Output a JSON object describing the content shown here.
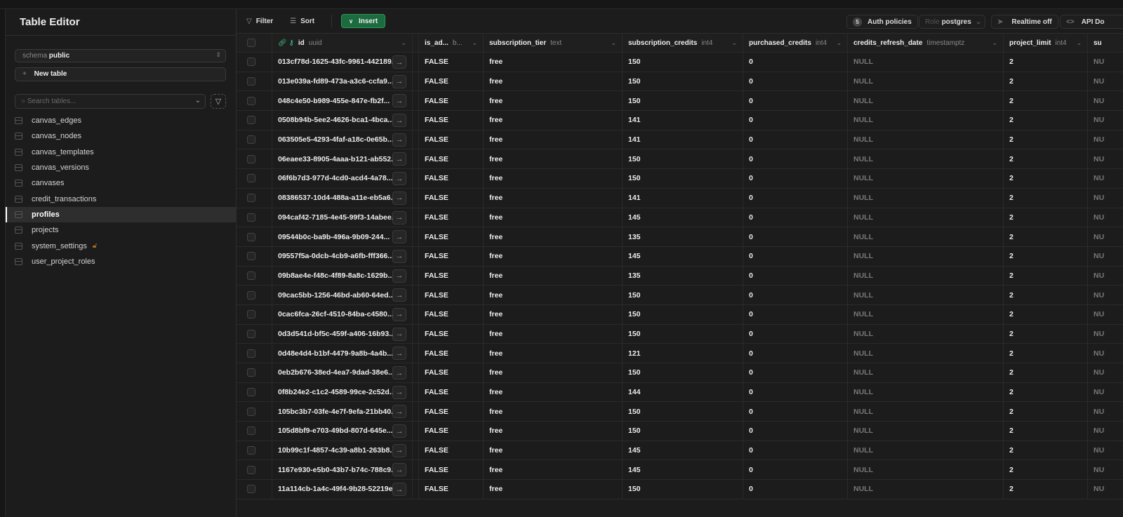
{
  "sidebar": {
    "title": "Table Editor",
    "schema_label": "schema",
    "schema_value": "public",
    "new_table": "New table",
    "search_placeholder": "Search tables...",
    "tables": [
      {
        "name": "canvas_edges"
      },
      {
        "name": "canvas_nodes"
      },
      {
        "name": "canvas_templates"
      },
      {
        "name": "canvas_versions"
      },
      {
        "name": "canvases"
      },
      {
        "name": "credit_transactions"
      },
      {
        "name": "profiles",
        "active": true
      },
      {
        "name": "projects"
      },
      {
        "name": "system_settings",
        "locked": true
      },
      {
        "name": "user_project_roles"
      }
    ]
  },
  "toolbar": {
    "filter": "Filter",
    "sort": "Sort",
    "insert": "Insert",
    "auth_count": "5",
    "auth_policies": "Auth policies",
    "role_label": "Role",
    "role_value": "postgres",
    "realtime": "Realtime off",
    "api_docs": "API Do"
  },
  "colors": {
    "accent": "#1b6b3e",
    "lock": "#b06f1d"
  },
  "columns": [
    {
      "name": "id",
      "type": "uuid"
    },
    {
      "name": "is_ad...",
      "type": "b..."
    },
    {
      "name": "subscription_tier",
      "type": "text"
    },
    {
      "name": "subscription_credits",
      "type": "int4"
    },
    {
      "name": "purchased_credits",
      "type": "int4"
    },
    {
      "name": "credits_refresh_date",
      "type": "timestamptz"
    },
    {
      "name": "project_limit",
      "type": "int4"
    },
    {
      "name": "su",
      "type": ""
    }
  ],
  "rows": [
    [
      "013cf78d-1625-43fc-9961-442189...",
      "FALSE",
      "free",
      "150",
      "0",
      "NULL",
      "2",
      "NU"
    ],
    [
      "013e039a-fd89-473a-a3c6-ccfa9...",
      "FALSE",
      "free",
      "150",
      "0",
      "NULL",
      "2",
      "NU"
    ],
    [
      "048c4e50-b989-455e-847e-fb2f...",
      "FALSE",
      "free",
      "150",
      "0",
      "NULL",
      "2",
      "NU"
    ],
    [
      "0508b94b-5ee2-4626-bca1-4bca...",
      "FALSE",
      "free",
      "141",
      "0",
      "NULL",
      "2",
      "NU"
    ],
    [
      "063505e5-4293-4faf-a18c-0e65b...",
      "FALSE",
      "free",
      "141",
      "0",
      "NULL",
      "2",
      "NU"
    ],
    [
      "06eaee33-8905-4aaa-b121-ab552...",
      "FALSE",
      "free",
      "150",
      "0",
      "NULL",
      "2",
      "NU"
    ],
    [
      "06f6b7d3-977d-4cd0-acd4-4a78...",
      "FALSE",
      "free",
      "150",
      "0",
      "NULL",
      "2",
      "NU"
    ],
    [
      "08386537-10d4-488a-a11e-eb5a6...",
      "FALSE",
      "free",
      "141",
      "0",
      "NULL",
      "2",
      "NU"
    ],
    [
      "094caf42-7185-4e45-99f3-14abee...",
      "FALSE",
      "free",
      "145",
      "0",
      "NULL",
      "2",
      "NU"
    ],
    [
      "09544b0c-ba9b-496a-9b09-244...",
      "FALSE",
      "free",
      "135",
      "0",
      "NULL",
      "2",
      "NU"
    ],
    [
      "09557f5a-0dcb-4cb9-a6fb-fff366...",
      "FALSE",
      "free",
      "145",
      "0",
      "NULL",
      "2",
      "NU"
    ],
    [
      "09b8ae4e-f48c-4f89-8a8c-1629b...",
      "FALSE",
      "free",
      "135",
      "0",
      "NULL",
      "2",
      "NU"
    ],
    [
      "09cac5bb-1256-46bd-ab60-64ed...",
      "FALSE",
      "free",
      "150",
      "0",
      "NULL",
      "2",
      "NU"
    ],
    [
      "0cac6fca-26cf-4510-84ba-c4580...",
      "FALSE",
      "free",
      "150",
      "0",
      "NULL",
      "2",
      "NU"
    ],
    [
      "0d3d541d-bf5c-459f-a406-16b93...",
      "FALSE",
      "free",
      "150",
      "0",
      "NULL",
      "2",
      "NU"
    ],
    [
      "0d48e4d4-b1bf-4479-9a8b-4a4b...",
      "FALSE",
      "free",
      "121",
      "0",
      "NULL",
      "2",
      "NU"
    ],
    [
      "0eb2b676-38ed-4ea7-9dad-38e6...",
      "FALSE",
      "free",
      "150",
      "0",
      "NULL",
      "2",
      "NU"
    ],
    [
      "0f8b24e2-c1c2-4589-99ce-2c52d...",
      "FALSE",
      "free",
      "144",
      "0",
      "NULL",
      "2",
      "NU"
    ],
    [
      "105bc3b7-03fe-4e7f-9efa-21bb40...",
      "FALSE",
      "free",
      "150",
      "0",
      "NULL",
      "2",
      "NU"
    ],
    [
      "105d8bf9-e703-49bd-807d-645e...",
      "FALSE",
      "free",
      "150",
      "0",
      "NULL",
      "2",
      "NU"
    ],
    [
      "10b99c1f-4857-4c39-a8b1-263b8...",
      "FALSE",
      "free",
      "145",
      "0",
      "NULL",
      "2",
      "NU"
    ],
    [
      "1167e930-e5b0-43b7-b74c-788c9...",
      "FALSE",
      "free",
      "145",
      "0",
      "NULL",
      "2",
      "NU"
    ],
    [
      "11a114cb-1a4c-49f4-9b28-52219ec...",
      "FALSE",
      "free",
      "150",
      "0",
      "NULL",
      "2",
      "NU"
    ]
  ]
}
